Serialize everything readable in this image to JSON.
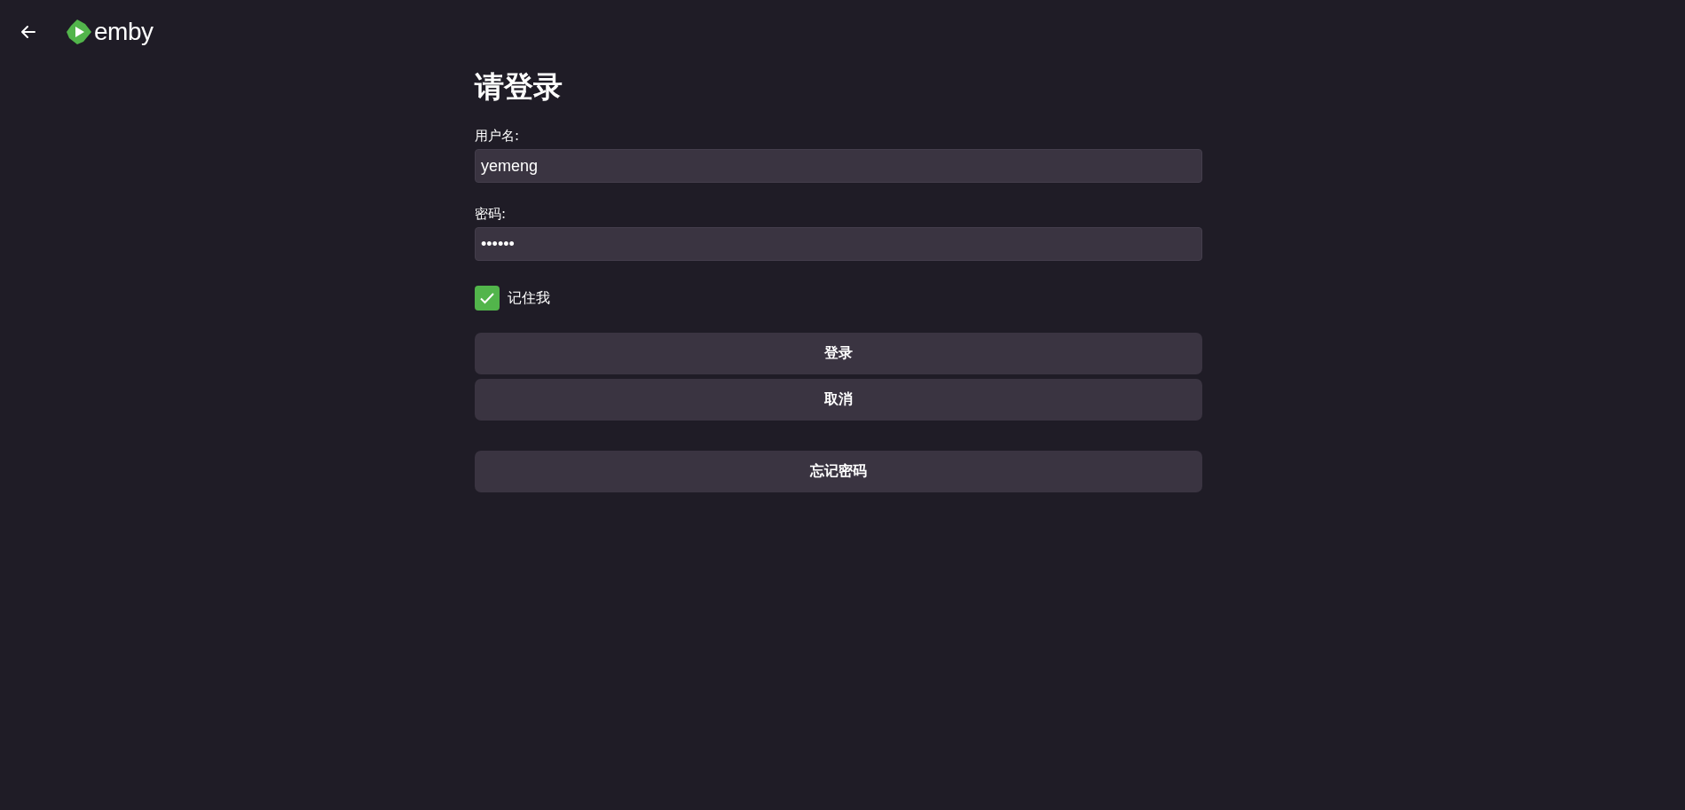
{
  "header": {
    "logo_text": "emby"
  },
  "form": {
    "title": "请登录",
    "fields": [
      {
        "label": "用户名:",
        "value": "yemeng"
      },
      {
        "label": "密码:",
        "value": "••••••"
      }
    ],
    "remember": {
      "label": "记住我",
      "checked": true
    },
    "buttons": [
      {
        "label": "登录",
        "kind": "primary"
      },
      {
        "label": "取消",
        "kind": "primary"
      },
      {
        "label": "忘记密码",
        "kind": "separate"
      }
    ]
  }
}
